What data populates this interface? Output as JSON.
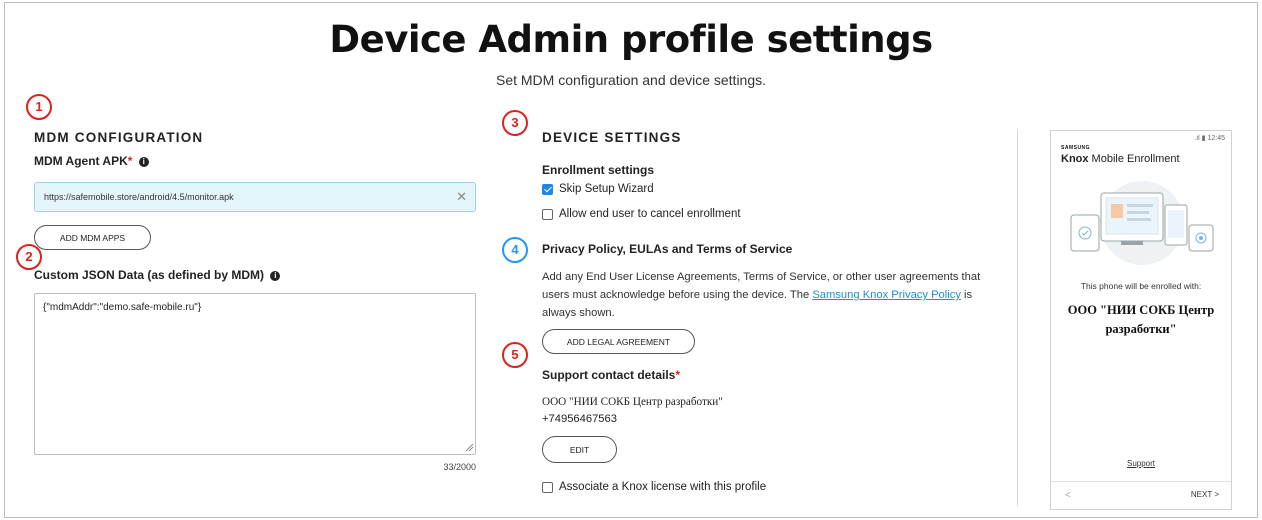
{
  "page": {
    "title": "Device Admin profile settings",
    "subtitle": "Set MDM configuration and device settings."
  },
  "markers": [
    "1",
    "2",
    "3",
    "4",
    "5"
  ],
  "mdm": {
    "heading": "MDM CONFIGURATION",
    "agent_label": "MDM Agent APK",
    "agent_required": "*",
    "agent_value": "https://safemobile.store/android/4.5/monitor.apk",
    "add_apps_button": "ADD MDM APPS",
    "json_label": "Custom JSON Data (as defined by MDM)",
    "json_value": "{\"mdmAddr\":\"demo.safe-mobile.ru\"}",
    "json_counter": "33/2000"
  },
  "device": {
    "heading": "DEVICE SETTINGS",
    "enrollment_label": "Enrollment settings",
    "skip_wizard": {
      "label": "Skip Setup Wizard",
      "checked": true
    },
    "allow_cancel": {
      "label": "Allow end user to cancel enrollment",
      "checked": false
    },
    "privacy_label": "Privacy Policy, EULAs and Terms of Service",
    "privacy_text_1": "Add any End User License Agreements, Terms of Service, or other user agreements that users must acknowledge before using the device. The ",
    "privacy_link": "Samsung Knox Privacy Policy",
    "privacy_text_2": " is always shown.",
    "add_legal_button": "ADD LEGAL AGREEMENT",
    "support_label": "Support contact details",
    "support_required": "*",
    "support_company": "ООО \"НИИ СОКБ Центр разработки\"",
    "support_phone": "+74956467563",
    "edit_button": "EDIT",
    "associate_license": {
      "label": "Associate a Knox license with this profile",
      "checked": false
    }
  },
  "preview": {
    "status": ".ıl ▮ 12:45",
    "brand": "SAMSUNG",
    "knox_bold": "Knox",
    "knox_rest": " Mobile Enrollment",
    "enrolled_text": "This phone will be enrolled with:",
    "company": "ООО \"НИИ СОКБ Центр разработки\"",
    "support": "Support",
    "prev": "<",
    "next": "NEXT  >"
  },
  "colors": {
    "marker_red": "#e0201a",
    "marker_blue": "#2196f3",
    "link": "#1a8fd1",
    "checkbox_checked": "#1e88e5",
    "apk_field_bg": "#e4f5fa"
  }
}
